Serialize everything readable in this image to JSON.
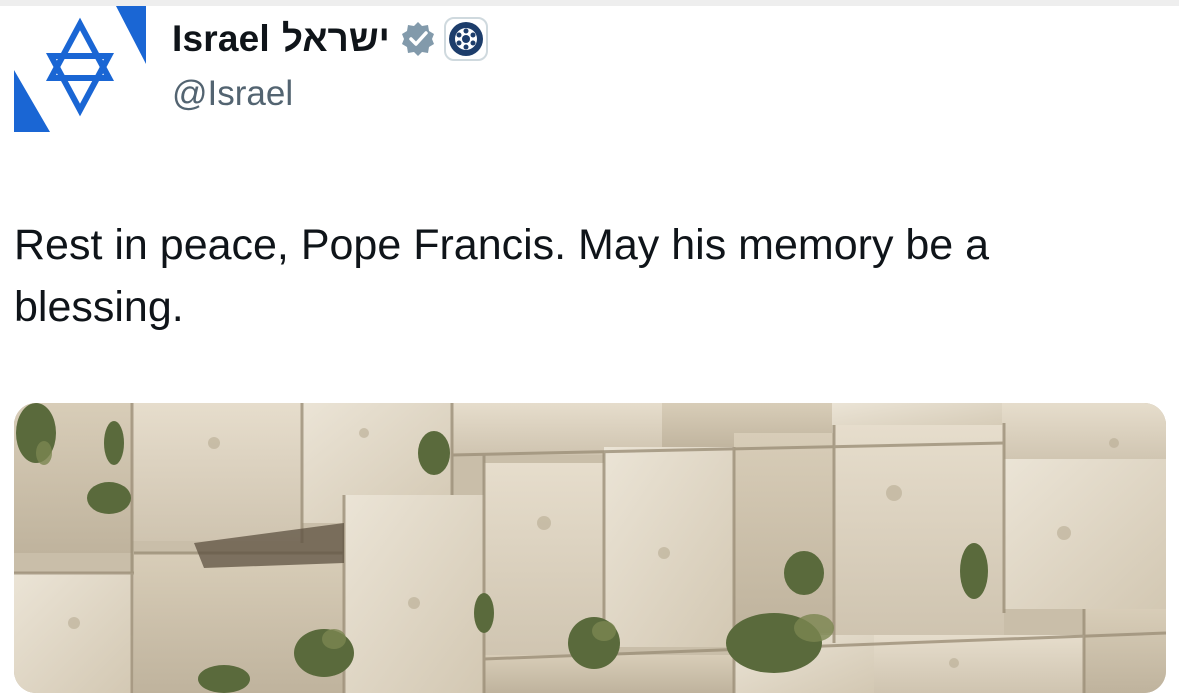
{
  "tweet": {
    "display_name": "Israel",
    "display_name_hebrew": "ישראל",
    "handle": "@Israel",
    "verified_badge_icon": "verified-badge-icon",
    "affiliation_icon": "government-affiliation-icon",
    "avatar_icon": "star-of-david-flag-icon",
    "text": "Rest in peace, Pope Francis. May his memory be a blessing.",
    "media": {
      "type": "photo",
      "subject_icon": "stone-wall-photo"
    }
  },
  "colors": {
    "brand_blue": "#1a66d4",
    "verified_gray": "#829aab",
    "text_primary": "#0f1419",
    "text_secondary": "#536471",
    "affiliation_navy": "#1d3d6b"
  }
}
